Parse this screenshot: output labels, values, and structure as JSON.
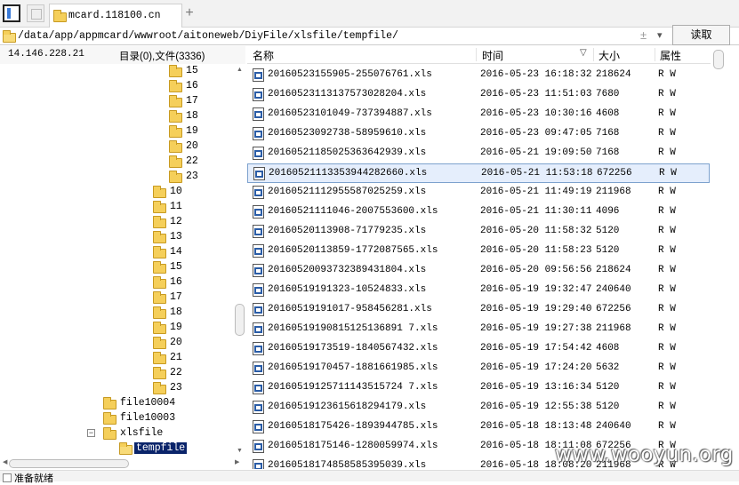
{
  "tab": {
    "title": "mcard.118100.cn",
    "new_tab": "+"
  },
  "address": {
    "path": "/data/app/appmcard/wwwroot/aitoneweb/DiyFile/xlsfile/tempfile/",
    "plusminus": "±",
    "dropdown": "▾"
  },
  "read_button": "读取",
  "left_header": {
    "ip": "14.146.228.21",
    "counts": "目录(0),文件(3336)"
  },
  "tree": [
    {
      "label": "15",
      "level": 3
    },
    {
      "label": "16",
      "level": 3
    },
    {
      "label": "17",
      "level": 3
    },
    {
      "label": "18",
      "level": 3
    },
    {
      "label": "19",
      "level": 3
    },
    {
      "label": "20",
      "level": 3
    },
    {
      "label": "22",
      "level": 3
    },
    {
      "label": "23",
      "level": 3
    },
    {
      "label": "10",
      "level": 2
    },
    {
      "label": "11",
      "level": 2
    },
    {
      "label": "12",
      "level": 2
    },
    {
      "label": "13",
      "level": 2
    },
    {
      "label": "14",
      "level": 2
    },
    {
      "label": "15",
      "level": 2
    },
    {
      "label": "16",
      "level": 2
    },
    {
      "label": "17",
      "level": 2
    },
    {
      "label": "18",
      "level": 2
    },
    {
      "label": "19",
      "level": 2
    },
    {
      "label": "20",
      "level": 2
    },
    {
      "label": "21",
      "level": 2
    },
    {
      "label": "22",
      "level": 2
    },
    {
      "label": "23",
      "level": 2
    },
    {
      "label": "file10004",
      "level": 1
    },
    {
      "label": "file10003",
      "level": 1
    },
    {
      "label": "xlsfile",
      "level": 1,
      "expander": "−"
    },
    {
      "label": "tempfile",
      "level": 1.5,
      "selected": true
    }
  ],
  "columns": {
    "name": "名称",
    "time": "时间",
    "size": "大小",
    "attr": "属性"
  },
  "files": [
    {
      "name": "20160523155905-255076761.xls",
      "time": "2016-05-23 16:18:32",
      "size": "218624",
      "attr": "R W"
    },
    {
      "name": "20160523113137573028204.xls",
      "time": "2016-05-23 11:51:03",
      "size": "7680",
      "attr": "R W"
    },
    {
      "name": "20160523101049-737394887.xls",
      "time": "2016-05-23 10:30:16",
      "size": "4608",
      "attr": "R W"
    },
    {
      "name": "20160523092738-58959610.xls",
      "time": "2016-05-23 09:47:05",
      "size": "7168",
      "attr": "R W"
    },
    {
      "name": "20160521185025363642939.xls",
      "time": "2016-05-21 19:09:50",
      "size": "7168",
      "attr": "R W"
    },
    {
      "name": "20160521113353944282660.xls",
      "time": "2016-05-21 11:53:18",
      "size": "672256",
      "attr": "R W",
      "selected": true
    },
    {
      "name": "20160521112955587025259.xls",
      "time": "2016-05-21 11:49:19",
      "size": "211968",
      "attr": "R W"
    },
    {
      "name": "20160521111046-2007553600.xls",
      "time": "2016-05-21 11:30:11",
      "size": "4096",
      "attr": "R W"
    },
    {
      "name": "20160520113908-71779235.xls",
      "time": "2016-05-20 11:58:32",
      "size": "5120",
      "attr": "R W"
    },
    {
      "name": "20160520113859-1772087565.xls",
      "time": "2016-05-20 11:58:23",
      "size": "5120",
      "attr": "R W"
    },
    {
      "name": "20160520093732389431804.xls",
      "time": "2016-05-20 09:56:56",
      "size": "218624",
      "attr": "R W"
    },
    {
      "name": "20160519191323-10524833.xls",
      "time": "2016-05-19 19:32:47",
      "size": "240640",
      "attr": "R W"
    },
    {
      "name": "20160519191017-958456281.xls",
      "time": "2016-05-19 19:29:40",
      "size": "672256",
      "attr": "R W"
    },
    {
      "name": "20160519190815125136891 7.xls",
      "time": "2016-05-19 19:27:38",
      "size": "211968",
      "attr": "R W"
    },
    {
      "name": "20160519173519-1840567432.xls",
      "time": "2016-05-19 17:54:42",
      "size": "4608",
      "attr": "R W"
    },
    {
      "name": "20160519170457-1881661985.xls",
      "time": "2016-05-19 17:24:20",
      "size": "5632",
      "attr": "R W"
    },
    {
      "name": "20160519125711143515724 7.xls",
      "time": "2016-05-19 13:16:34",
      "size": "5120",
      "attr": "R W"
    },
    {
      "name": "20160519123615618294179.xls",
      "time": "2016-05-19 12:55:38",
      "size": "5120",
      "attr": "R W"
    },
    {
      "name": "20160518175426-1893944785.xls",
      "time": "2016-05-18 18:13:48",
      "size": "240640",
      "attr": "R W"
    },
    {
      "name": "20160518175146-1280059974.xls",
      "time": "2016-05-18 18:11:08",
      "size": "672256",
      "attr": "R W"
    },
    {
      "name": "20160518174858585395039.xls",
      "time": "2016-05-18 18:08:20",
      "size": "211968",
      "attr": "R W"
    }
  ],
  "status": "准备就绪",
  "watermark": "www.wooyun.org"
}
